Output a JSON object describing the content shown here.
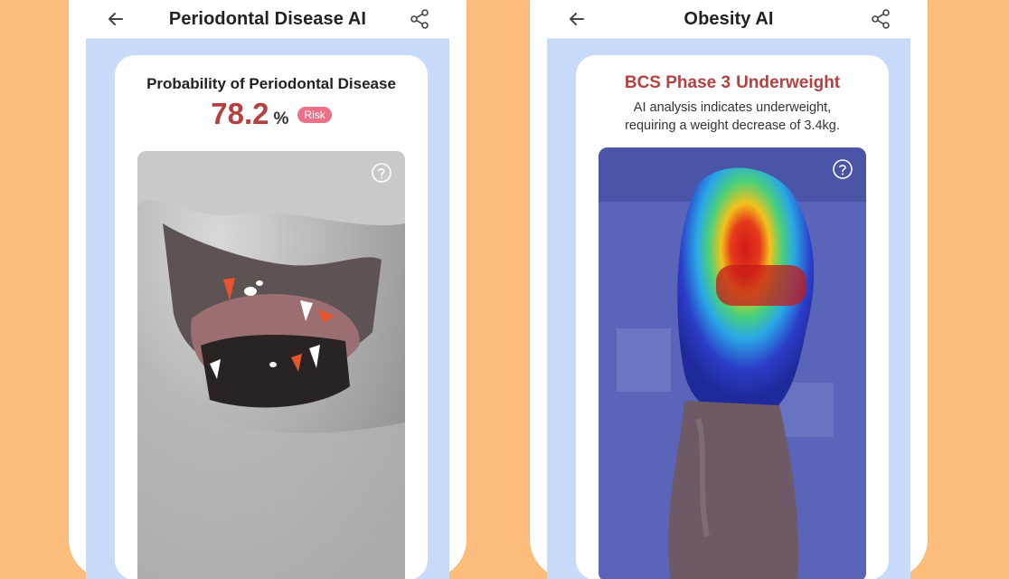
{
  "colors": {
    "background": "#fdbd7d",
    "content_bg": "#c8dafa",
    "accent_red": "#b5403f",
    "risk_badge": "#ee6f88",
    "heatmap_cool": "#5a64b8"
  },
  "left_phone": {
    "appbar": {
      "title": "Periodontal Disease AI",
      "back_icon": "arrow-left-icon",
      "share_icon": "share-icon"
    },
    "card": {
      "title": "Probability of Periodontal Disease",
      "probability_value": "78.2",
      "probability_unit": "%",
      "risk_badge": "Risk",
      "help_icon": "question-circle-icon",
      "image": "dog-mouth-teeth-segmentation"
    }
  },
  "right_phone": {
    "appbar": {
      "title": "Obesity AI",
      "back_icon": "arrow-left-icon",
      "share_icon": "share-icon"
    },
    "card": {
      "phase": "BCS Phase 3",
      "status": "Underweight",
      "description_line1": "AI analysis indicates underweight,",
      "description_line2": "requiring a weight decrease of 3.4kg.",
      "help_icon": "question-circle-icon",
      "image": "dog-body-heatmap"
    }
  }
}
